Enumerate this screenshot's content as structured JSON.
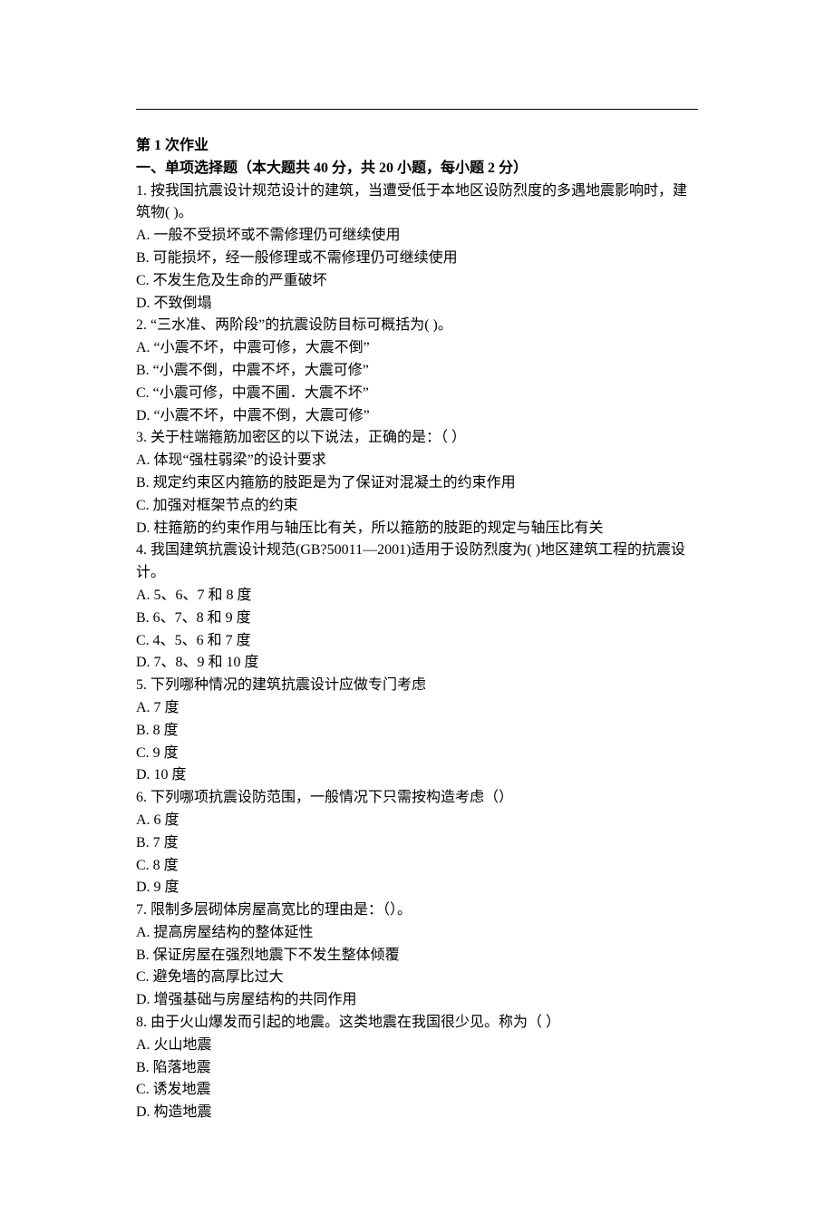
{
  "header": {
    "assignment_title": "第 1 次作业",
    "section_title": "一、单项选择题（本大题共 40 分，共 20 小题，每小题 2 分）"
  },
  "questions": [
    {
      "number": "1.",
      "text": "按我国抗震设计规范设计的建筑，当遭受低于本地区设防烈度的多遇地震影响时，建筑物( )。",
      "options": [
        {
          "label": "A.",
          "text": "一般不受损坏或不需修理仍可继续使用"
        },
        {
          "label": "B.",
          "text": "可能损坏，经一般修理或不需修理仍可继续使用"
        },
        {
          "label": "C.",
          "text": "不发生危及生命的严重破坏"
        },
        {
          "label": "D.",
          "text": "不致倒塌"
        }
      ]
    },
    {
      "number": "2.",
      "text": "“三水准、两阶段”的抗震设防目标可概括为( )。",
      "options": [
        {
          "label": "A.",
          "text": "“小震不坏，中震可修，大震不倒”"
        },
        {
          "label": "B.",
          "text": "“小震不倒，中震不坏，大震可修”"
        },
        {
          "label": "C.",
          "text": "“小震可修，中震不圃．大震不坏”"
        },
        {
          "label": "D.",
          "text": "“小震不坏，中震不倒，大震可修”"
        }
      ]
    },
    {
      "number": "3.",
      "text": "关于柱端箍筋加密区的以下说法，正确的是：（ ）",
      "options": [
        {
          "label": "A.",
          "text": "体现“强柱弱梁”的设计要求"
        },
        {
          "label": "B.",
          "text": "规定约束区内箍筋的肢距是为了保证对混凝土的约束作用"
        },
        {
          "label": "C.",
          "text": "加强对框架节点的约束"
        },
        {
          "label": "D.",
          "text": "柱箍筋的约束作用与轴压比有关，所以箍筋的肢距的规定与轴压比有关"
        }
      ]
    },
    {
      "number": "4.",
      "text": "我国建筑抗震设计规范(GB?50011—2001)适用于设防烈度为( )地区建筑工程的抗震设计。",
      "options": [
        {
          "label": "A.",
          "text": "5、6、7 和 8 度"
        },
        {
          "label": "B.",
          "text": "6、7、8 和 9 度"
        },
        {
          "label": "C.",
          "text": "4、5、6 和 7 度"
        },
        {
          "label": "D.",
          "text": "7、8、9 和 10 度"
        }
      ]
    },
    {
      "number": "5.",
      "text": "下列哪种情况的建筑抗震设计应做专门考虑",
      "options": [
        {
          "label": "A.",
          "text": "7 度"
        },
        {
          "label": "B.",
          "text": "8 度"
        },
        {
          "label": "C.",
          "text": "9 度"
        },
        {
          "label": "D.",
          "text": "10 度"
        }
      ]
    },
    {
      "number": "6.",
      "text": "下列哪项抗震设防范围，一般情况下只需按构造考虑（）",
      "options": [
        {
          "label": "A.",
          "text": "6 度"
        },
        {
          "label": "B.",
          "text": "7 度"
        },
        {
          "label": "C.",
          "text": "8 度"
        },
        {
          "label": "D.",
          "text": "9 度"
        }
      ]
    },
    {
      "number": "7.",
      "text": "限制多层砌体房屋高宽比的理由是：（）。",
      "options": [
        {
          "label": "A.",
          "text": "提高房屋结构的整体延性"
        },
        {
          "label": "B.",
          "text": "保证房屋在强烈地震下不发生整体倾覆"
        },
        {
          "label": "C.",
          "text": "避免墙的高厚比过大"
        },
        {
          "label": "D.",
          "text": "增强基础与房屋结构的共同作用"
        }
      ]
    },
    {
      "number": "8.",
      "text": "由于火山爆发而引起的地震。这类地震在我国很少见。称为（ ）",
      "options": [
        {
          "label": "A.",
          "text": "火山地震"
        },
        {
          "label": "B.",
          "text": "陷落地震"
        },
        {
          "label": "C.",
          "text": "诱发地震"
        },
        {
          "label": "D.",
          "text": "构造地震"
        }
      ]
    }
  ]
}
